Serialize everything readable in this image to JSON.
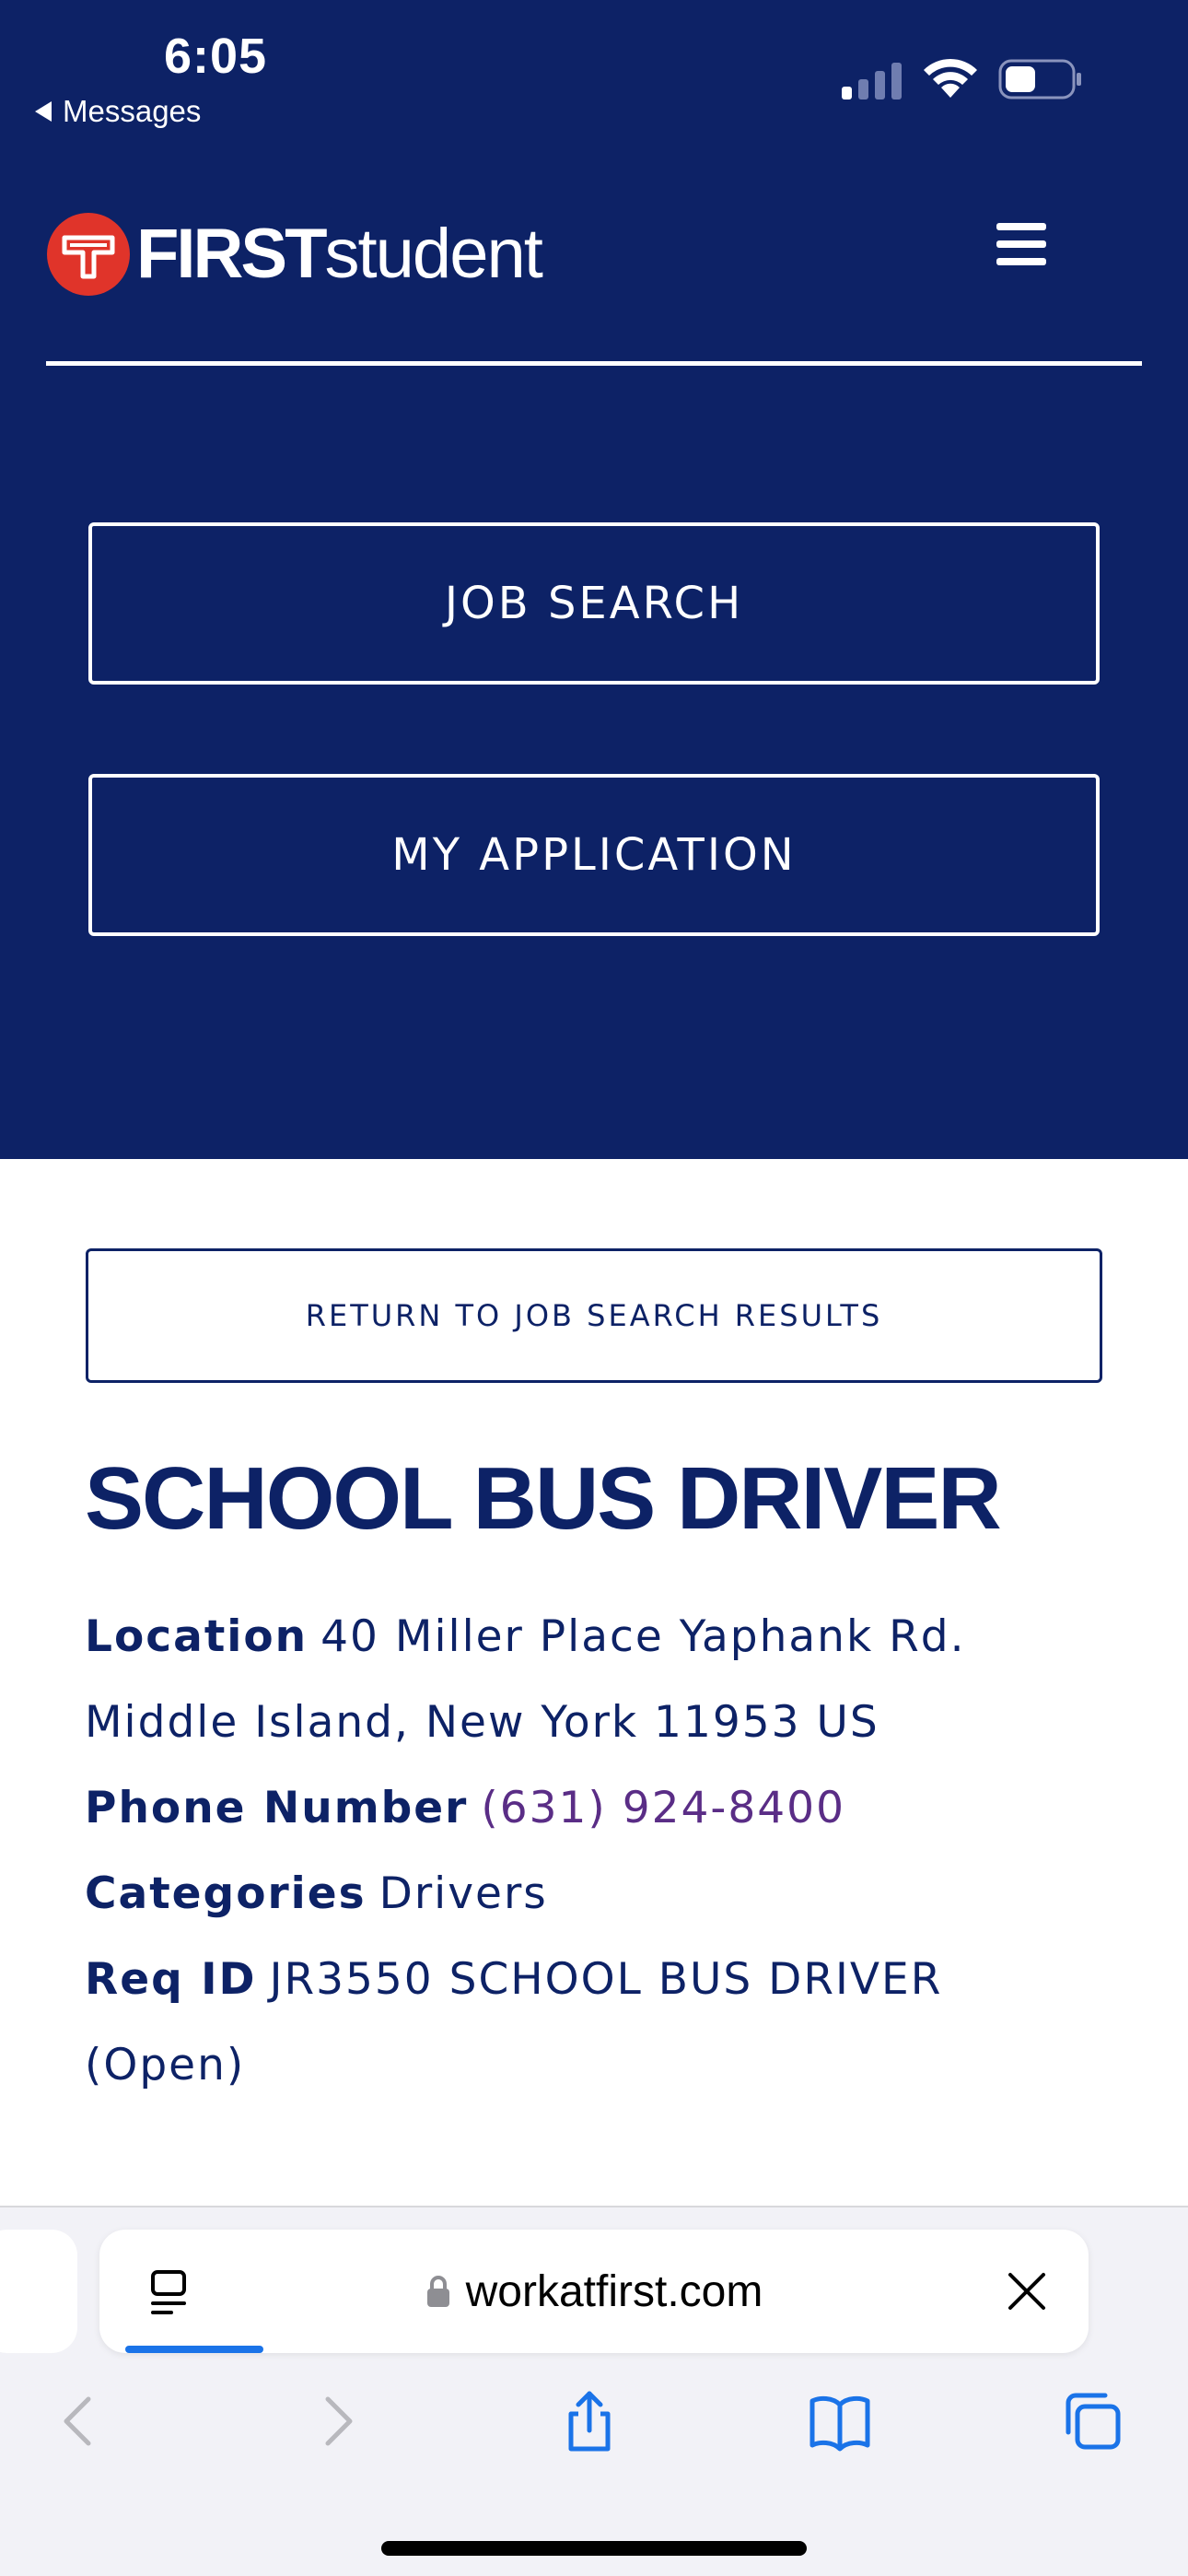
{
  "status_bar": {
    "time": "6:05",
    "back_label": "Messages"
  },
  "header": {
    "logo_bold": "FIRST",
    "logo_light": "student",
    "menu_icon": "hamburger-menu-icon"
  },
  "hero": {
    "job_search_label": "JOB SEARCH",
    "my_application_label": "MY APPLICATION"
  },
  "content": {
    "return_label": "RETURN TO JOB SEARCH RESULTS",
    "job_title": "SCHOOL BUS DRIVER",
    "location_label": "Location",
    "location_value": "40 Miller Place Yaphank Rd. Middle Island, New York 11953 US",
    "phone_label": "Phone Number",
    "phone_value": "(631) 924-8400",
    "categories_label": "Categories",
    "categories_value": "Drivers",
    "req_label": "Req ID",
    "req_value": "JR3550 SCHOOL BUS DRIVER (Open)"
  },
  "browser": {
    "url": "workatfirst.com",
    "accent": "#1a73e8"
  },
  "colors": {
    "navy": "#0d2266",
    "phone_link": "#5a2d86",
    "logo_red": "#e0342a"
  }
}
